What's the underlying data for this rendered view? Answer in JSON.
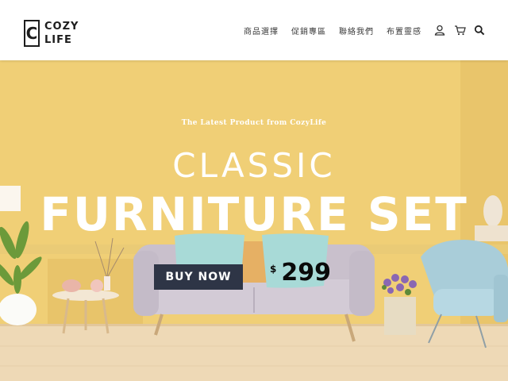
{
  "brand": {
    "initial": "C",
    "line1": "COZY",
    "line2": "LIFE"
  },
  "nav": {
    "items": [
      {
        "label": "商品選擇"
      },
      {
        "label": "促銷專區"
      },
      {
        "label": "聯絡我們"
      },
      {
        "label": "布置靈感"
      }
    ],
    "icons": [
      "user-icon",
      "cart-icon",
      "search-icon"
    ]
  },
  "hero": {
    "tagline": "The Latest Product from CozyLife",
    "title_line1": "CLASSIC",
    "title_line2": "FURNITURE SET",
    "cta_label": "BUY NOW",
    "price_currency": "$",
    "price_value": "299"
  },
  "colors": {
    "wall": "#f0cf76",
    "button": "#2e3546",
    "sofa": "#ccc3d0",
    "cushion": "#a8dad7",
    "chair": "#a9cdd9"
  }
}
